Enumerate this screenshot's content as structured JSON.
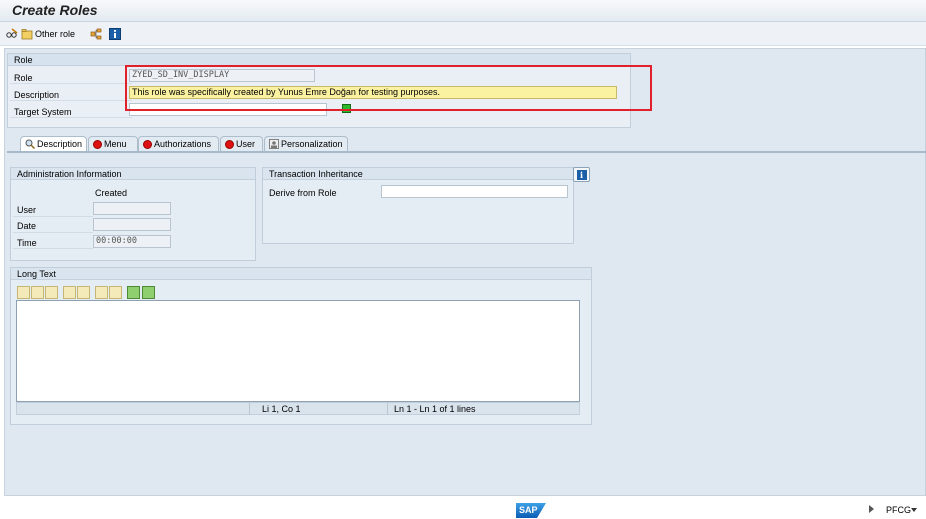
{
  "title": "Create Roles",
  "toolbar": {
    "other_role": "Other role"
  },
  "role_group": {
    "header": "Role",
    "role_label": "Role",
    "role_value": "ZYED_SD_INV_DISPLAY",
    "description_label": "Description",
    "description_value": "This role was specifically created by Yunus Emre Doğan for testing purposes.",
    "target_label": "Target System",
    "target_value": ""
  },
  "tabs": [
    {
      "label": "Description",
      "status": "active"
    },
    {
      "label": "Menu",
      "status": "red"
    },
    {
      "label": "Authorizations",
      "status": "red"
    },
    {
      "label": "User",
      "status": "red"
    },
    {
      "label": "Personalization",
      "status": "neutral"
    }
  ],
  "admin": {
    "header": "Administration Information",
    "col_created": "Created",
    "user_label": "User",
    "user_value": "",
    "date_label": "Date",
    "date_value": "",
    "time_label": "Time",
    "time_value": "00:00:00"
  },
  "inheritance": {
    "header": "Transaction Inheritance",
    "derive_label": "Derive from Role",
    "derive_value": ""
  },
  "long_text": {
    "header": "Long Text",
    "position": "Li 1, Co 1",
    "lines": "Ln 1 - Ln 1 of 1 lines"
  },
  "footer": {
    "transaction": "PFCG"
  },
  "colors": {
    "highlight": "#e0202b",
    "description_bg": "#fbf2a1",
    "status_red": "#d11111"
  }
}
